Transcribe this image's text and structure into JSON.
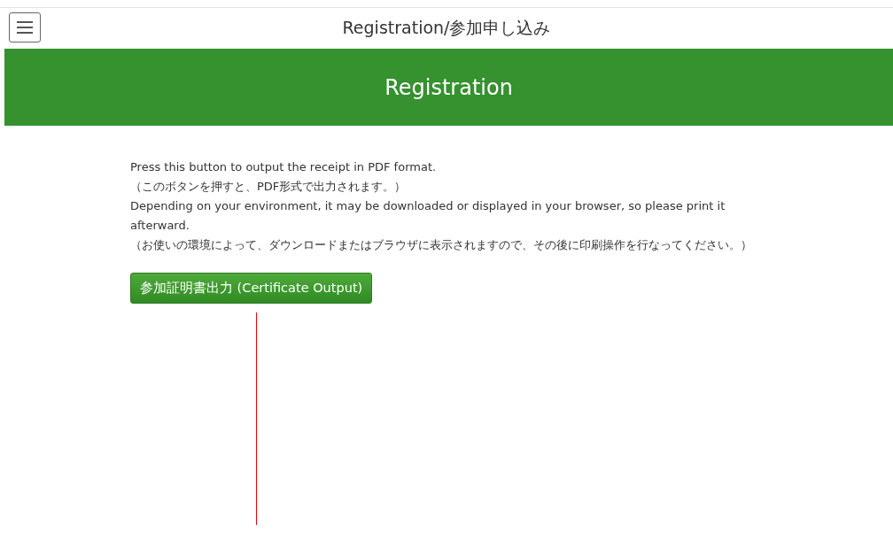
{
  "header": {
    "title": "Registration/参加申し込み"
  },
  "banner": {
    "title": "Registration"
  },
  "instructions": [
    "Press this button to output the receipt in PDF format.",
    "（このボタンを押すと、PDF形式で出力されます。）",
    "Depending on your environment, it may be downloaded or displayed in your browser, so please print it afterward.",
    "（お使いの環境によって、ダウンロードまたはブラウザに表示されますので、その後に印刷操作を行なってください。）"
  ],
  "button": {
    "label": "参加証明書出力 (Certificate Output)"
  }
}
